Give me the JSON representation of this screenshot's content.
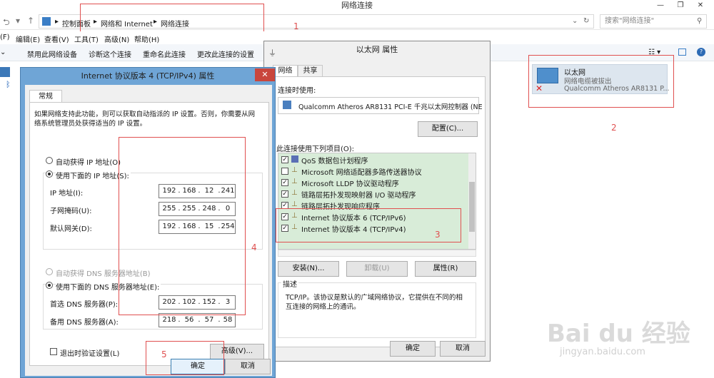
{
  "window": {
    "title": "网络连接"
  },
  "address": {
    "crumbs": [
      "控制面板",
      "网络和 Internet",
      "网络连接"
    ],
    "search_placeholder": "搜索\"网络连接\""
  },
  "menu": {
    "items": [
      "(F)",
      "编辑(E)",
      "查看(V)",
      "工具(T)",
      "高级(N)",
      "帮助(H)"
    ]
  },
  "toolbar": {
    "items": [
      "禁用此网络设备",
      "诊断这个连接",
      "重命名此连接",
      "更改此连接的设置"
    ]
  },
  "adapter": {
    "name": "以太网",
    "status": "网络电缆被拔出",
    "device": "Qualcomm Atheros AR8131 P..."
  },
  "annotations": {
    "n1": "1",
    "n2": "2",
    "n3": "3",
    "n4": "4",
    "n5": "5"
  },
  "ipv4": {
    "title": "Internet 协议版本 4 (TCP/IPv4) 属性",
    "tab": "常规",
    "intro": "如果网络支持此功能，则可以获取自动指派的 IP 设置。否则，你需要从网络系统管理员处获得适当的 IP 设置。",
    "auto_ip": "自动获得 IP 地址(O)",
    "manual_ip": "使用下面的 IP 地址(S):",
    "ip_label": "IP 地址(I):",
    "mask_label": "子网掩码(U):",
    "gw_label": "默认网关(D):",
    "ip": [
      "192",
      "168",
      "12",
      "241"
    ],
    "mask": [
      "255",
      "255",
      "248",
      "0"
    ],
    "gw": [
      "192",
      "168",
      "15",
      "254"
    ],
    "auto_dns": "自动获得 DNS 服务器地址(B)",
    "manual_dns": "使用下面的 DNS 服务器地址(E):",
    "dns1_label": "首选 DNS 服务器(P):",
    "dns2_label": "备用 DNS 服务器(A):",
    "dns1": [
      "202",
      "102",
      "152",
      "3"
    ],
    "dns2": [
      "218",
      "56",
      "57",
      "58"
    ],
    "validate": "退出时验证设置(L)",
    "advanced": "高级(V)...",
    "ok": "确定",
    "cancel": "取消"
  },
  "eth": {
    "title": "以太网 属性",
    "tabs": [
      "网络",
      "共享"
    ],
    "connect_using": "连接时使用:",
    "adapter": "Qualcomm Atheros AR8131 PCI-E 千兆以太网控制器 (NE",
    "configure": "配置(C)...",
    "items_label": "此连接使用下列项目(O):",
    "items": [
      {
        "label": "QoS 数据包计划程序",
        "checked": true
      },
      {
        "label": "Microsoft 网络适配器多路传送器协议",
        "checked": false
      },
      {
        "label": "Microsoft LLDP 协议驱动程序",
        "checked": true
      },
      {
        "label": "链路层拓扑发现映射器 I/O 驱动程序",
        "checked": true
      },
      {
        "label": "链路层拓扑发现响应程序",
        "checked": true
      },
      {
        "label": "Internet 协议版本 6 (TCP/IPv6)",
        "checked": true
      },
      {
        "label": "Internet 协议版本 4 (TCP/IPv4)",
        "checked": true
      }
    ],
    "install": "安装(N)...",
    "uninstall": "卸载(U)",
    "properties": "属性(R)",
    "desc_label": "描述",
    "desc": "TCP/IP。该协议是默认的广域网络协议，它提供在不同的相互连接的网络上的通讯。",
    "ok": "确定",
    "cancel": "取消"
  },
  "watermark": {
    "line1": "Bai du 经验",
    "line2": "jingyan.baidu.com"
  }
}
